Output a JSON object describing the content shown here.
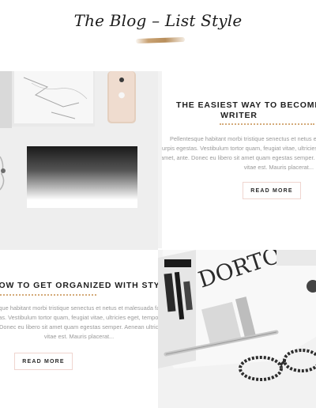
{
  "header": {
    "title": "The Blog – List Style"
  },
  "posts": [
    {
      "title_line1": "THE EASIEST WAY TO BECOME A SUCCESSFUL",
      "title_line2": "WRITER",
      "excerpt_lines": [
        "Pellentesque habitant morbi tristique senectus et netus et malesuada fames ac",
        "turpis egestas. Vestibulum tortor quam, feugiat vitae, ultricies eget, tempor sit",
        "amet, ante. Donec eu libero sit amet quam egestas semper. Aenean ultricies mi",
        "vitae est. Mauris placerat..."
      ],
      "button": "READ MORE",
      "image_alt": "Desk flat lay with marble notebook, phone and clutch"
    },
    {
      "title_line1": "HOW TO GET ORGANIZED WITH STYLE",
      "excerpt_lines": [
        "Pellentesque habitant morbi tristique senectus et netus et malesuada fames ac",
        "turpis egestas. Vestibulum tortor quam, feugiat vitae, ultricies eget, tempor sit",
        "amet, ante. Donec eu libero sit amet quam egestas semper. Aenean ultricies mi",
        "vitae est. Mauris placerat..."
      ],
      "button": "READ MORE",
      "image_alt": "Magazine, pen and glasses on desk"
    }
  ]
}
